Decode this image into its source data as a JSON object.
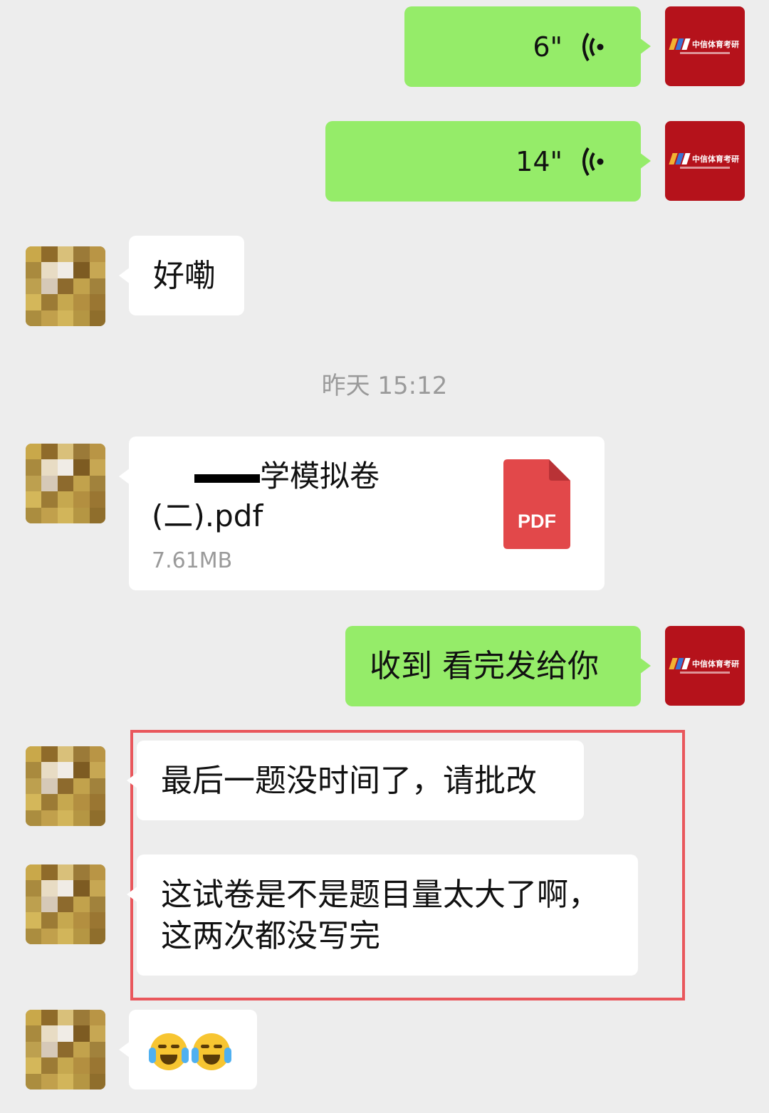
{
  "messages": {
    "voice1": {
      "duration": "6\""
    },
    "voice2": {
      "duration": "14\""
    },
    "reply1": "好嘞",
    "timestamp": "昨天 15:12",
    "file": {
      "name_line1": "学模拟卷",
      "name_line2": "(二).pdf",
      "size": "7.61MB",
      "type_label": "PDF"
    },
    "reply2": "收到 看完发给你",
    "msg3": "最后一题没时间了，请批改",
    "msg4_line1": "这试卷是不是题目量太大了啊，",
    "msg4_line2": "这两次都没写完"
  },
  "avatar_me": {
    "logo_text": "中信体育考研"
  },
  "colors": {
    "background": "#ededed",
    "my_bubble": "#95ec69",
    "other_bubble": "#ffffff",
    "avatar_brand": "#b5121b",
    "highlight": "#e9575c",
    "pdf_red": "#e2484a"
  },
  "emoji": [
    "crying-laughing-face",
    "crying-laughing-face"
  ]
}
